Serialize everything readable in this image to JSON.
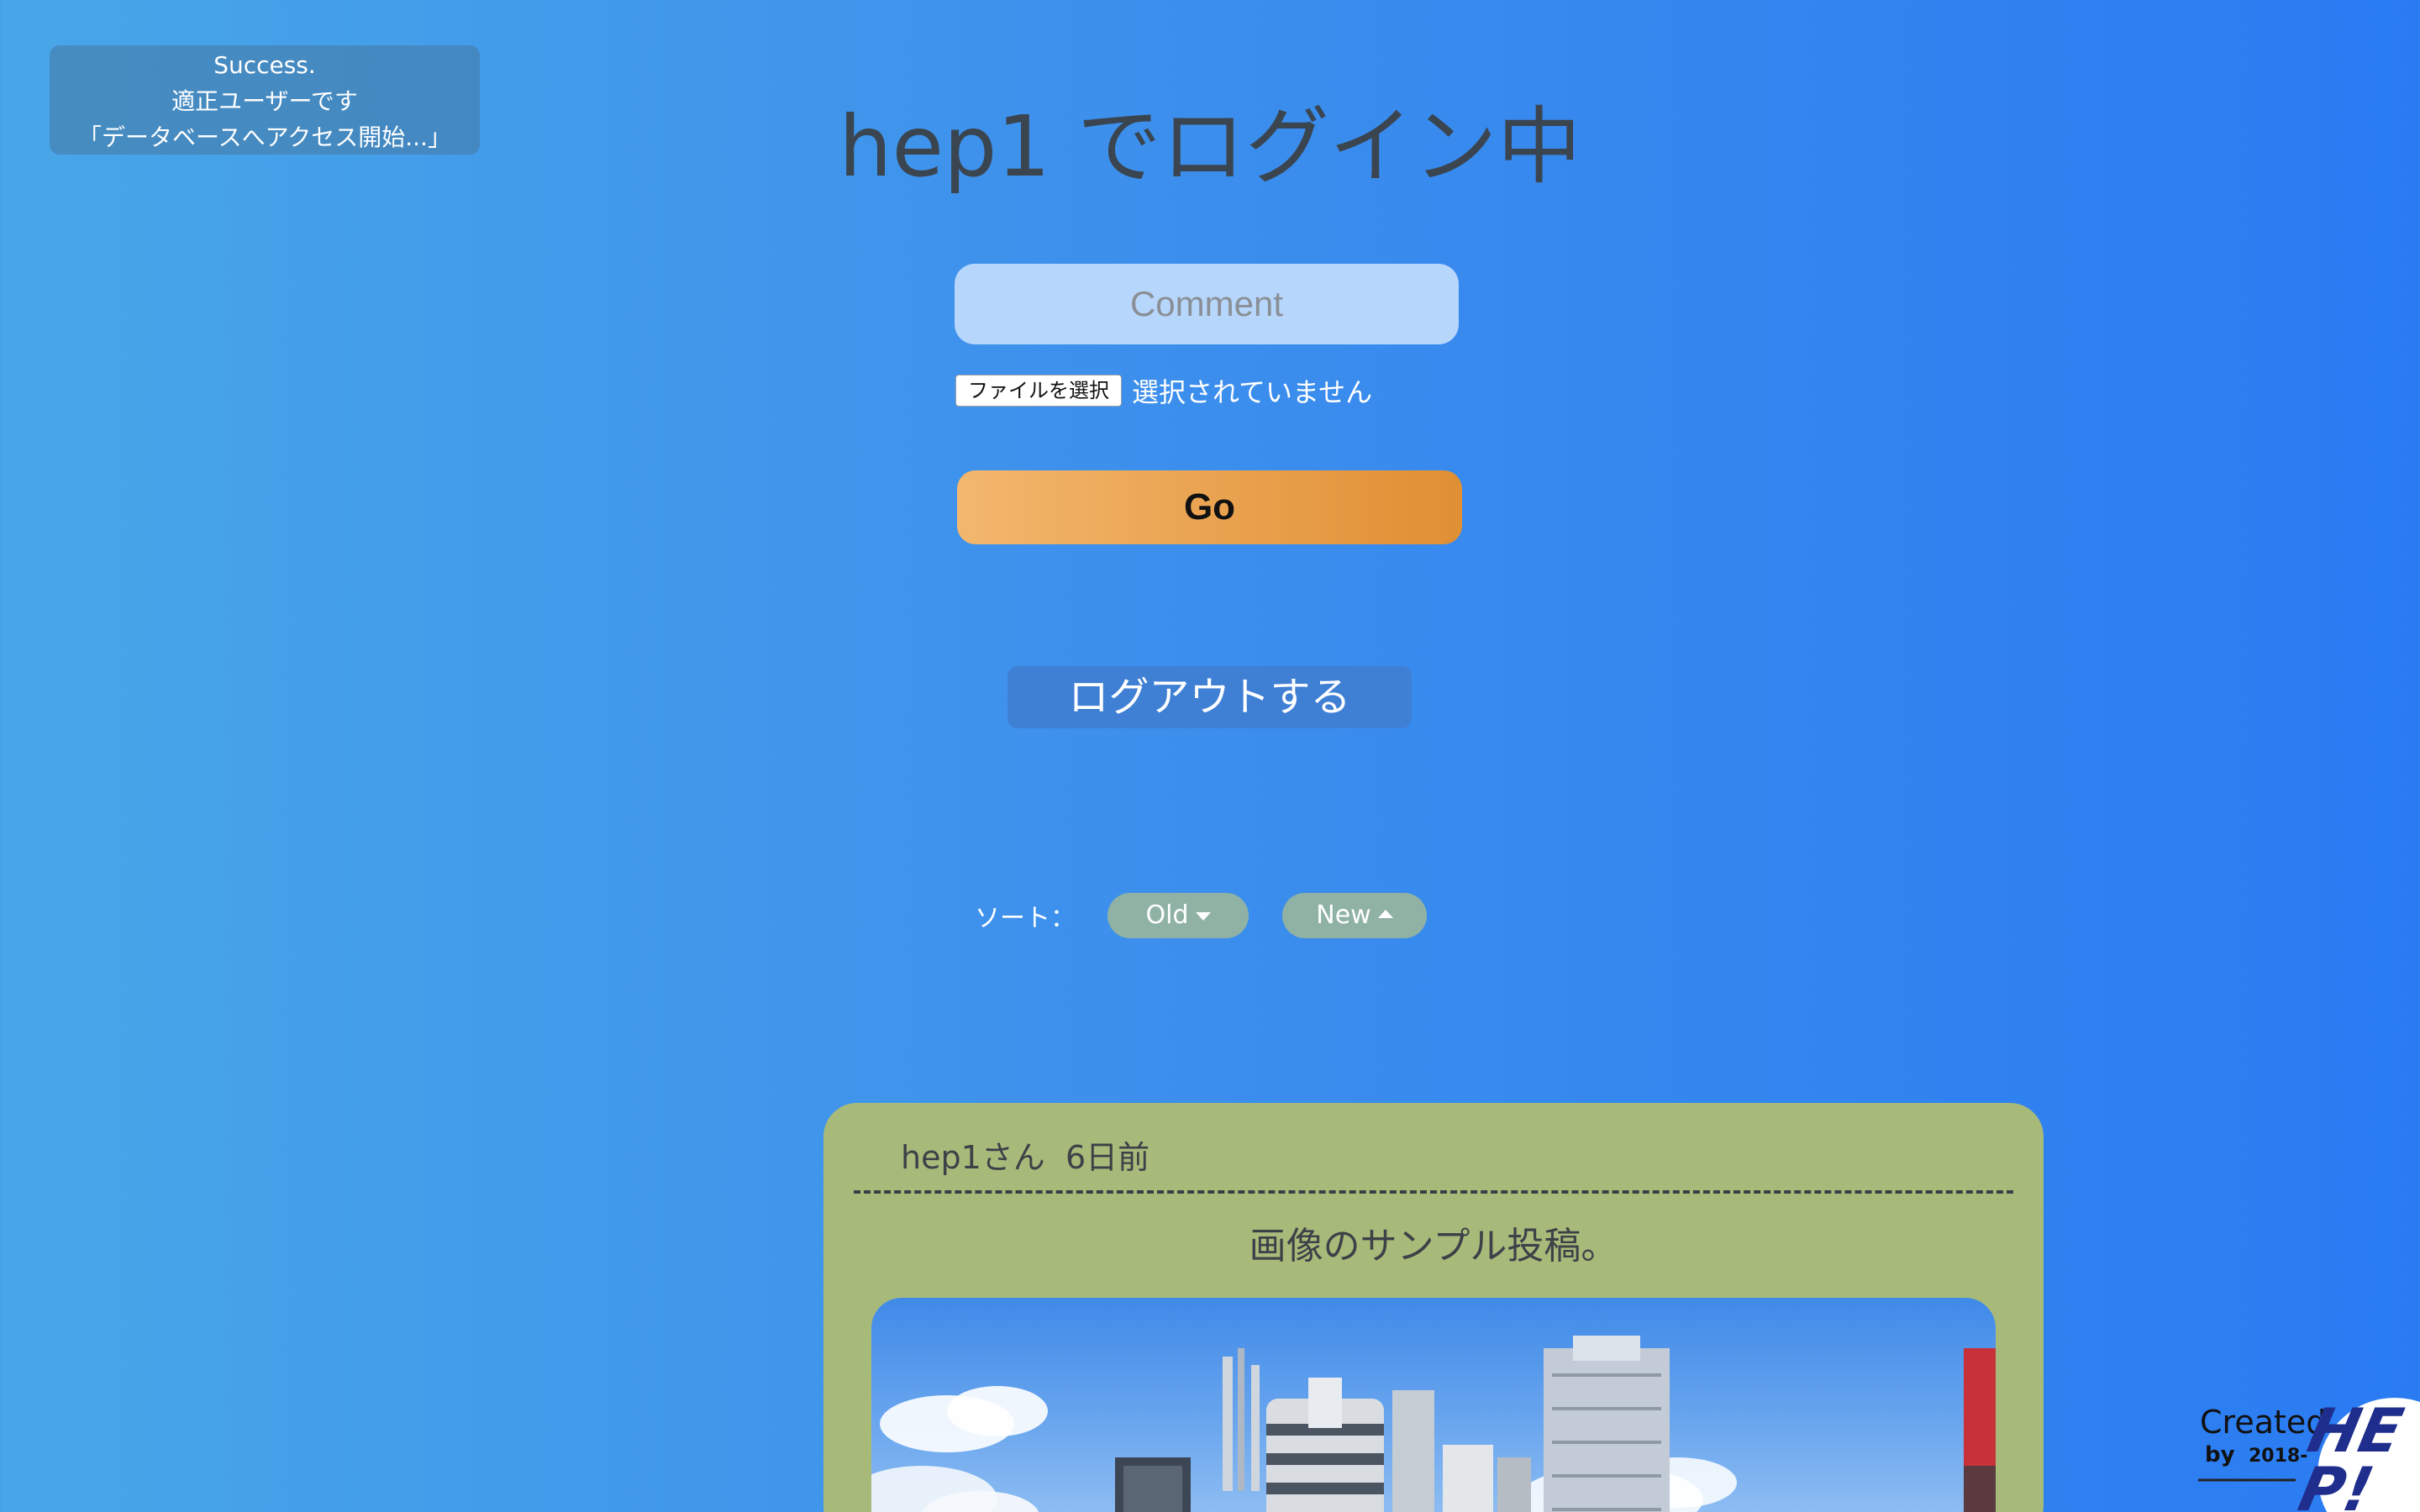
{
  "toast": {
    "line1": "Success.",
    "line2": "適正ユーザーです",
    "line3": "「データベースへアクセス開始...」"
  },
  "page": {
    "title": "hep1 でログイン中"
  },
  "form": {
    "comment_placeholder": "Comment",
    "file_button_label": "ファイルを選択",
    "file_status": "選択されていません",
    "submit_label": "Go"
  },
  "logout": {
    "label": "ログアウトする"
  },
  "sort": {
    "label": "ソート：",
    "old_label": "Old",
    "new_label": "New"
  },
  "posts": [
    {
      "author": "hep1さん",
      "time": "6日前",
      "text": "画像のサンプル投稿。"
    }
  ],
  "credit": {
    "created": "Created",
    "by": "by",
    "year": "2018-",
    "logo_text": "HEP!"
  },
  "colors": {
    "background_start": "#48a6e8",
    "background_end": "#2a7bf2",
    "go_button_start": "#f3b76e",
    "go_button_end": "#e08f33",
    "post_card": "#a8ba7a",
    "sort_button": "#90b2a5",
    "logout_button": "#3f7fd4",
    "comment_field": "#b7d6fb"
  }
}
